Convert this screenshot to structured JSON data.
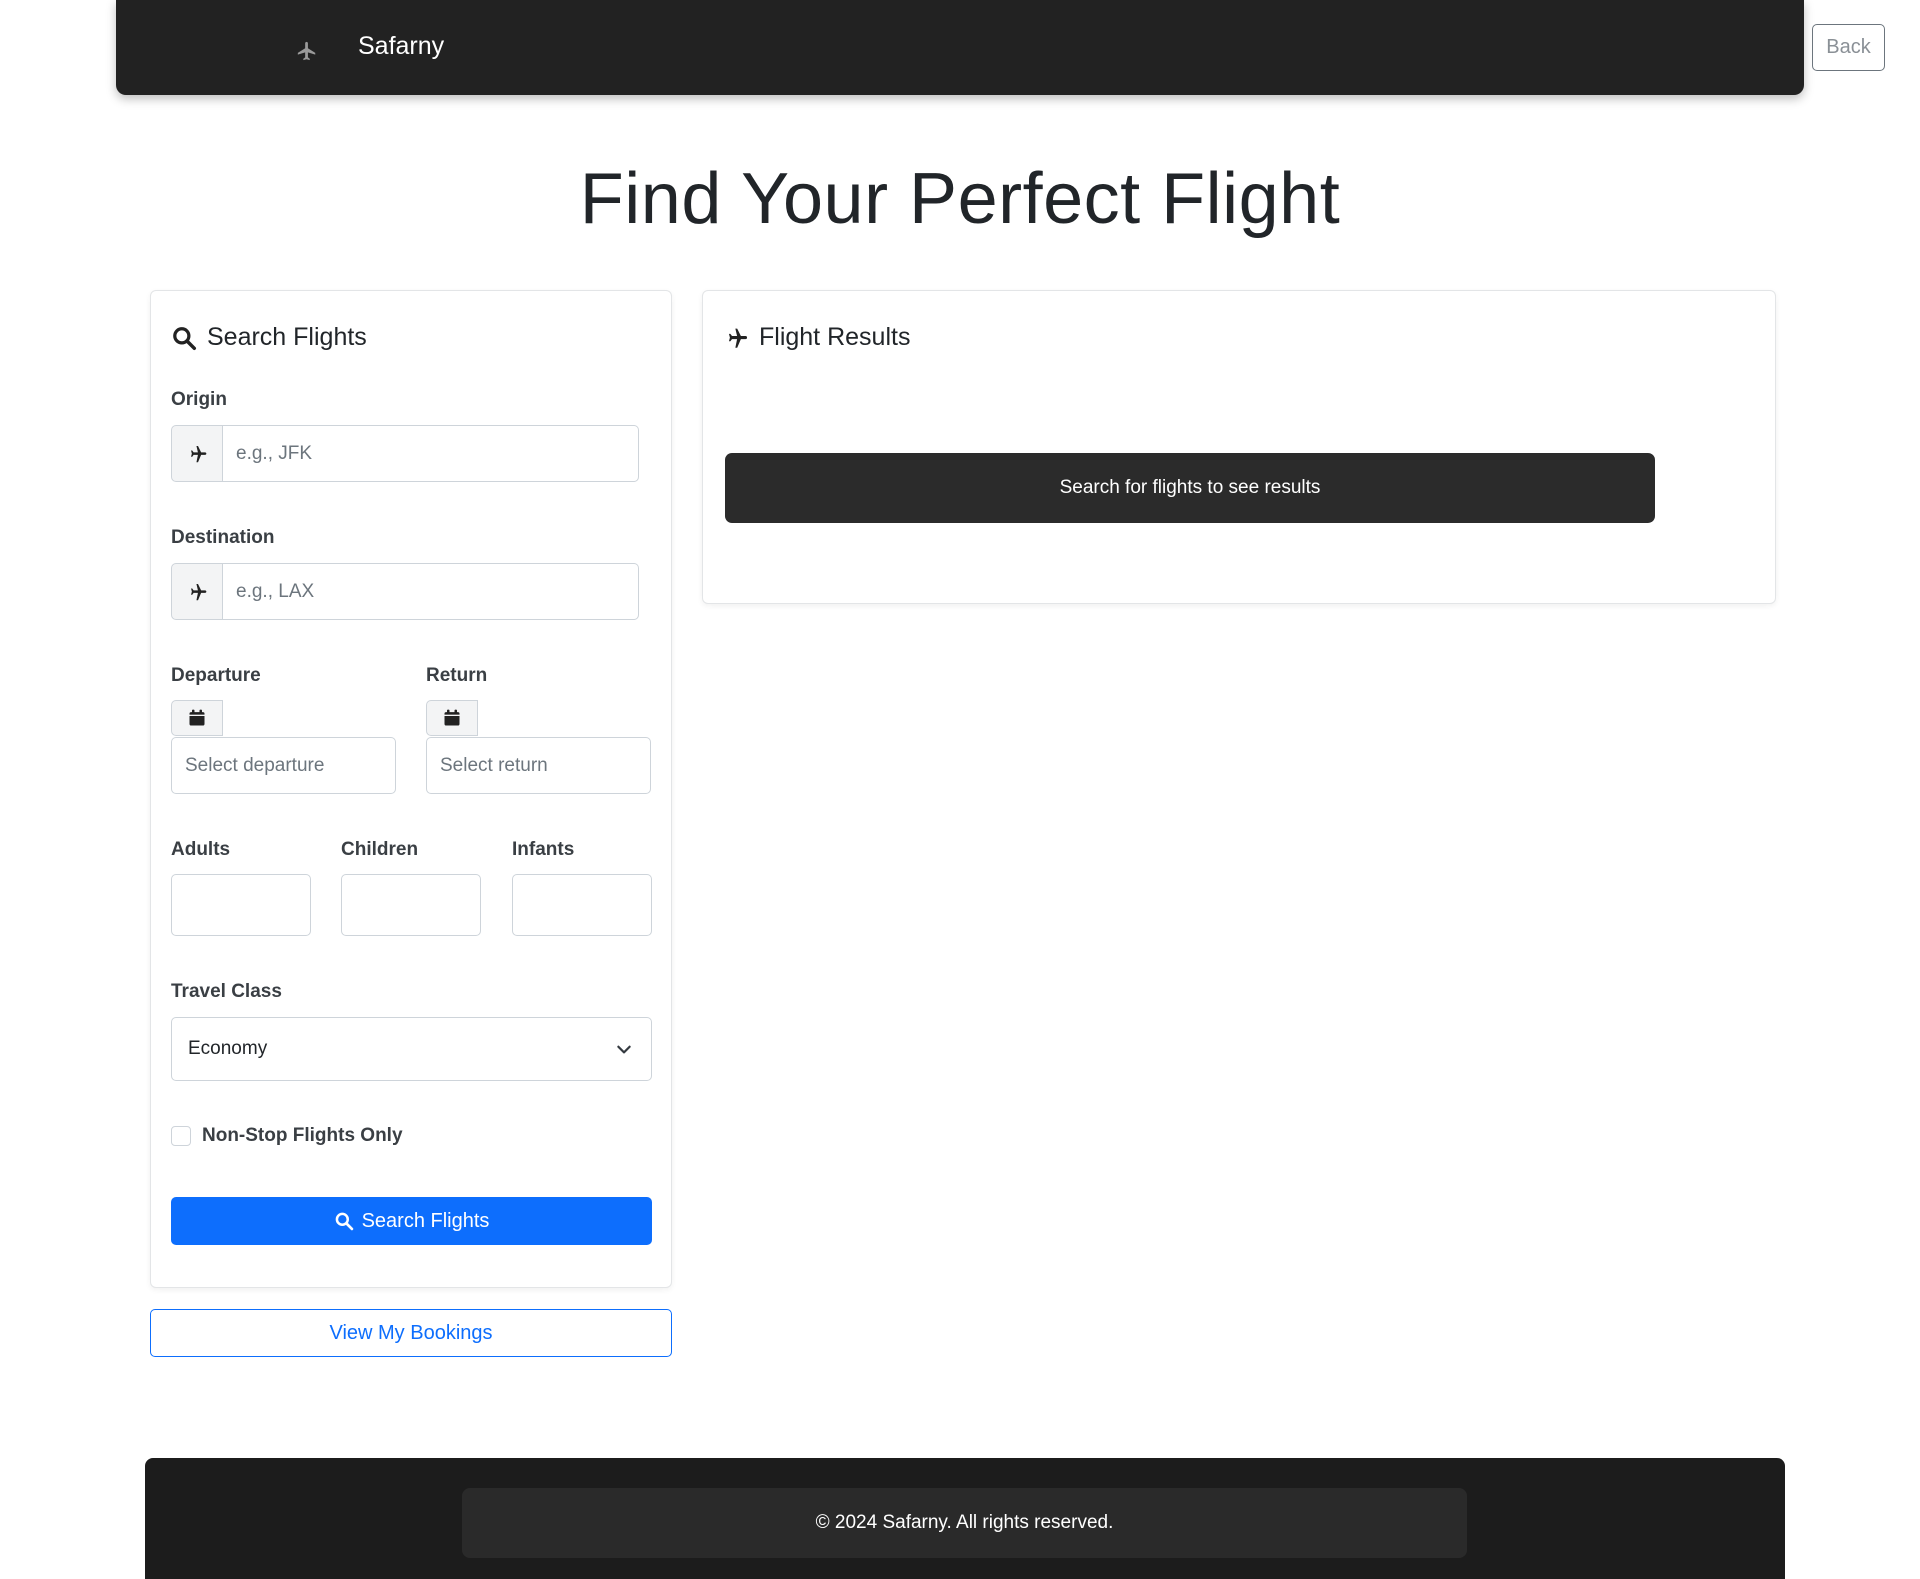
{
  "navbar": {
    "brand": "Safarny",
    "back_label": "Back"
  },
  "page": {
    "title": "Find Your Perfect Flight"
  },
  "search": {
    "title": "Search Flights",
    "origin_label": "Origin",
    "origin_placeholder": "e.g., JFK",
    "destination_label": "Destination",
    "destination_placeholder": "e.g., LAX",
    "departure_label": "Departure",
    "departure_placeholder": "Select departure",
    "return_label": "Return",
    "return_placeholder": "Select return",
    "adults_label": "Adults",
    "children_label": "Children",
    "infants_label": "Infants",
    "class_label": "Travel Class",
    "class_value": "Economy",
    "nonstop_label": "Non-Stop Flights Only",
    "submit_label": "Search Flights"
  },
  "bookings_label": "View My Bookings",
  "results": {
    "title": "Flight Results",
    "empty_message": "Search for flights to see results"
  },
  "footer": {
    "text": "© 2024 Safarny. All rights reserved."
  },
  "icons": {
    "brand": "plane-logo-icon",
    "search": "search-icon",
    "plane": "plane-icon",
    "calendar": "calendar-icon",
    "chevron": "chevron-down-icon"
  },
  "colors": {
    "primary": "#0d6efd",
    "navbar": "#222222",
    "footer": "#1c1c1c"
  }
}
